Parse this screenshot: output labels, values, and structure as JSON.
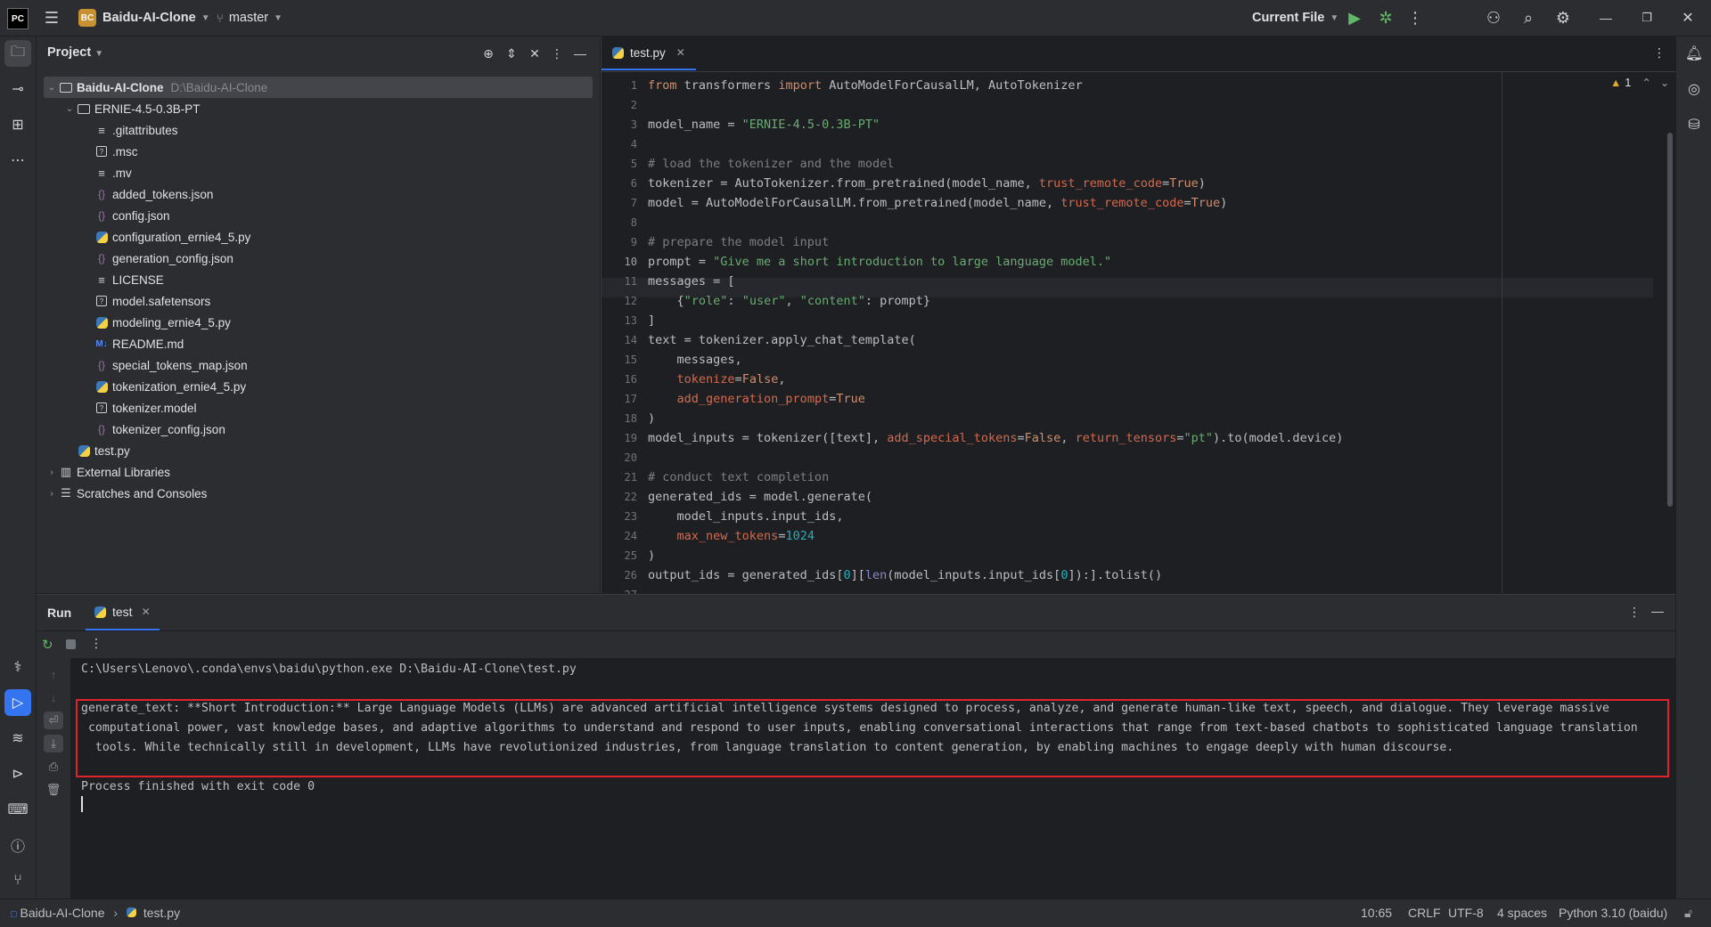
{
  "titlebar": {
    "logo": "PC",
    "project_badge": "BC",
    "project_name": "Baidu-AI-Clone",
    "branch": "master",
    "run_config": "Current File"
  },
  "project_panel": {
    "title": "Project",
    "tree": [
      {
        "label": "Baidu-AI-Clone",
        "path": "D:\\Baidu-AI-Clone",
        "kind": "folder",
        "expanded": true,
        "depth": 0
      },
      {
        "label": "ERNIE-4.5-0.3B-PT",
        "kind": "folder",
        "expanded": true,
        "depth": 1
      },
      {
        "label": ".gitattributes",
        "kind": "text",
        "depth": 2
      },
      {
        "label": ".msc",
        "kind": "unknown",
        "depth": 2
      },
      {
        "label": ".mv",
        "kind": "text",
        "depth": 2
      },
      {
        "label": "added_tokens.json",
        "kind": "json",
        "depth": 2
      },
      {
        "label": "config.json",
        "kind": "json",
        "depth": 2
      },
      {
        "label": "configuration_ernie4_5.py",
        "kind": "python",
        "depth": 2
      },
      {
        "label": "generation_config.json",
        "kind": "json",
        "depth": 2
      },
      {
        "label": "LICENSE",
        "kind": "text",
        "depth": 2
      },
      {
        "label": "model.safetensors",
        "kind": "unknown",
        "depth": 2
      },
      {
        "label": "modeling_ernie4_5.py",
        "kind": "python",
        "depth": 2
      },
      {
        "label": "README.md",
        "kind": "markdown",
        "depth": 2
      },
      {
        "label": "special_tokens_map.json",
        "kind": "json",
        "depth": 2
      },
      {
        "label": "tokenization_ernie4_5.py",
        "kind": "python",
        "depth": 2
      },
      {
        "label": "tokenizer.model",
        "kind": "unknown",
        "depth": 2
      },
      {
        "label": "tokenizer_config.json",
        "kind": "json",
        "depth": 2
      },
      {
        "label": "test.py",
        "kind": "python",
        "depth": 1
      },
      {
        "label": "External Libraries",
        "kind": "library",
        "expanded": false,
        "depth": 0
      },
      {
        "label": "Scratches and Consoles",
        "kind": "scratch",
        "expanded": false,
        "depth": 0
      }
    ]
  },
  "editor": {
    "tab_label": "test.py",
    "warning_count": "1",
    "current_line": 10,
    "lines": [
      [
        [
          "kw",
          "from"
        ],
        [
          "t",
          " transformers "
        ],
        [
          "kw",
          "import"
        ],
        [
          "t",
          " AutoModelForCausalLM, AutoTokenizer"
        ]
      ],
      [],
      [
        [
          "t",
          "model_name = "
        ],
        [
          "str",
          "\"ERNIE-4.5-0.3B-PT\""
        ]
      ],
      [],
      [
        [
          "cm",
          "# load the tokenizer and the model"
        ]
      ],
      [
        [
          "t",
          "tokenizer = AutoTokenizer.from_pretrained(model_name, "
        ],
        [
          "prm",
          "trust_remote_code"
        ],
        [
          "t",
          "="
        ],
        [
          "kw",
          "True"
        ],
        [
          "t",
          ")"
        ]
      ],
      [
        [
          "t",
          "model = AutoModelForCausalLM.from_pretrained(model_name, "
        ],
        [
          "prm",
          "trust_remote_code"
        ],
        [
          "t",
          "="
        ],
        [
          "kw",
          "True"
        ],
        [
          "t",
          ")"
        ]
      ],
      [],
      [
        [
          "cm",
          "# prepare the model input"
        ]
      ],
      [
        [
          "t",
          "prompt = "
        ],
        [
          "str",
          "\"Give me a short introduction to large language model.\""
        ]
      ],
      [
        [
          "t",
          "messages = ["
        ]
      ],
      [
        [
          "t",
          "    {"
        ],
        [
          "str",
          "\"role\""
        ],
        [
          "t",
          ": "
        ],
        [
          "str",
          "\"user\""
        ],
        [
          "t",
          ", "
        ],
        [
          "str",
          "\"content\""
        ],
        [
          "t",
          ": prompt}"
        ]
      ],
      [
        [
          "t",
          "]"
        ]
      ],
      [
        [
          "t",
          "text = tokenizer.apply_chat_template("
        ]
      ],
      [
        [
          "t",
          "    messages,"
        ]
      ],
      [
        [
          "t",
          "    "
        ],
        [
          "prm",
          "tokenize"
        ],
        [
          "t",
          "="
        ],
        [
          "kw",
          "False"
        ],
        [
          "t",
          ","
        ]
      ],
      [
        [
          "t",
          "    "
        ],
        [
          "prm",
          "add_generation_prompt"
        ],
        [
          "t",
          "="
        ],
        [
          "kw",
          "True"
        ]
      ],
      [
        [
          "t",
          ")"
        ]
      ],
      [
        [
          "t",
          "model_inputs = tokenizer([text], "
        ],
        [
          "prm",
          "add_special_tokens"
        ],
        [
          "t",
          "="
        ],
        [
          "kw",
          "False"
        ],
        [
          "t",
          ", "
        ],
        [
          "prm",
          "return_tensors"
        ],
        [
          "t",
          "="
        ],
        [
          "str",
          "\"pt\""
        ],
        [
          "t",
          ").to(model.device)"
        ]
      ],
      [],
      [
        [
          "cm",
          "# conduct text completion"
        ]
      ],
      [
        [
          "t",
          "generated_ids = model.generate("
        ]
      ],
      [
        [
          "t",
          "    model_inputs.input_ids,"
        ]
      ],
      [
        [
          "t",
          "    "
        ],
        [
          "prm",
          "max_new_tokens"
        ],
        [
          "t",
          "="
        ],
        [
          "num",
          "1024"
        ]
      ],
      [
        [
          "t",
          ")"
        ]
      ],
      [
        [
          "t",
          "output_ids = generated_ids["
        ],
        [
          "num",
          "0"
        ],
        [
          "t",
          "]["
        ],
        [
          "bi",
          "len"
        ],
        [
          "t",
          "(model_inputs.input_ids["
        ],
        [
          "num",
          "0"
        ],
        [
          "t",
          "]):].tolist()"
        ]
      ],
      []
    ]
  },
  "run_panel": {
    "title": "Run",
    "tab_label": "test",
    "console": {
      "command": "C:\\Users\\Lenovo\\.conda\\envs\\baidu\\python.exe D:\\Baidu-AI-Clone\\test.py",
      "output_lines": [
        "generate_text: **Short Introduction:** Large Language Models (LLMs) are advanced artificial intelligence systems designed to process, analyze, and generate human-like text, speech, and dialogue. They leverage massive",
        " computational power, vast knowledge bases, and adaptive algorithms to understand and respond to user inputs, enabling conversational interactions that range from text-based chatbots to sophisticated language translation",
        "  tools. While technically still in development, LLMs have revolutionized industries, from language translation to content generation, by enabling machines to engage deeply with human discourse."
      ],
      "exit_message": "Process finished with exit code 0"
    }
  },
  "statusbar": {
    "breadcrumb_project": "Baidu-AI-Clone",
    "breadcrumb_file": "test.py",
    "position": "10:65",
    "line_ending": "CRLF",
    "encoding": "UTF-8",
    "indent": "4 spaces",
    "interpreter": "Python 3.10 (baidu)"
  },
  "colors": {
    "accent": "#3574f0",
    "highlight_box": "#e0242a",
    "keyword": "#cf8e6d",
    "string": "#6aab73",
    "comment": "#7a7e85",
    "param": "#d5694d",
    "number": "#2aacb8"
  }
}
